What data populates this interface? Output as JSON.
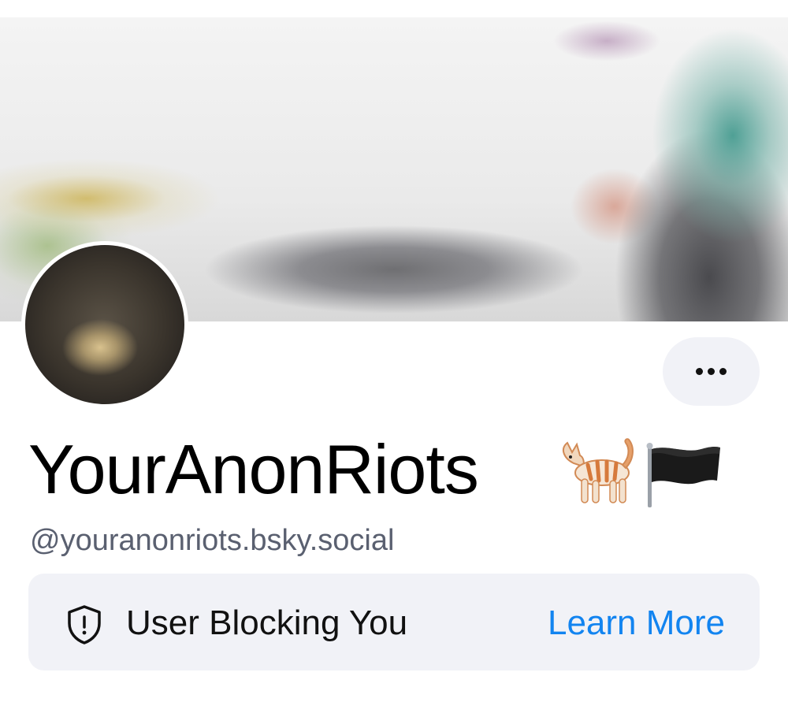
{
  "profile": {
    "display_name": "YourAnonRiots",
    "name_emoji": [
      "cat-emoji",
      "black-flag-emoji"
    ],
    "handle": "@youranonriots.bsky.social"
  },
  "actions": {
    "more_icon": "more-horizontal-icon"
  },
  "blocking_notice": {
    "icon": "shield-alert-icon",
    "text": "User Blocking You",
    "link_label": "Learn More",
    "link_color": "#1284f0"
  },
  "colors": {
    "handle": "#5a6070",
    "notice_bg": "#f1f2f7"
  }
}
